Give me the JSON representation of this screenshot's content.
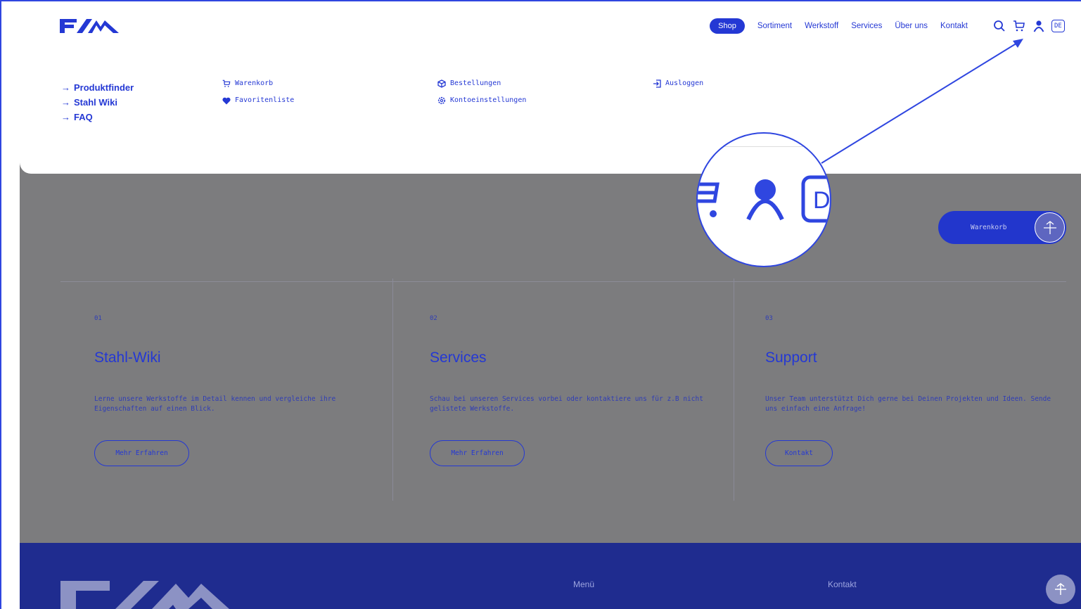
{
  "header": {
    "nav": [
      "Shop",
      "Sortiment",
      "Werkstoff",
      "Services",
      "Über uns",
      "Kontakt"
    ],
    "lang": "DE",
    "icons": [
      "search-icon",
      "cart-icon",
      "user-icon"
    ]
  },
  "dropdown": {
    "quick_links": [
      "Produktfinder",
      "Stahl Wiki",
      "FAQ"
    ],
    "col1": [
      "Warenkorb",
      "Favoritenliste"
    ],
    "col2": [
      "Bestellungen",
      "Kontoeinstellungen"
    ],
    "col3": [
      "Ausloggen"
    ]
  },
  "floating": {
    "cart_label": "Warenkorb"
  },
  "zoom": {
    "lang_fragment": "D"
  },
  "cards": [
    {
      "num": "01",
      "title": "Stahl-Wiki",
      "text": "Lerne unsere Werkstoffe im Detail kennen und vergleiche ihre Eigenschaften auf einen Blick.",
      "button": "Mehr Erfahren"
    },
    {
      "num": "02",
      "title": "Services",
      "text": "Schau bei unseren Services vorbei oder kontaktiere uns für z.B nicht gelistete Werkstoffe.",
      "button": "Mehr Erfahren"
    },
    {
      "num": "03",
      "title": "Support",
      "text": "Unser Team unterstützt Dich gerne bei Deinen Projekten und Ideen. Sende uns einfach eine Anfrage!",
      "button": "Kontakt"
    }
  ],
  "footer": {
    "menu": "Menü",
    "contact": "Kontakt"
  },
  "colors": {
    "brand": "#2438d4",
    "backdrop": "#7c7c7e",
    "footer": "#1f2c8f"
  }
}
